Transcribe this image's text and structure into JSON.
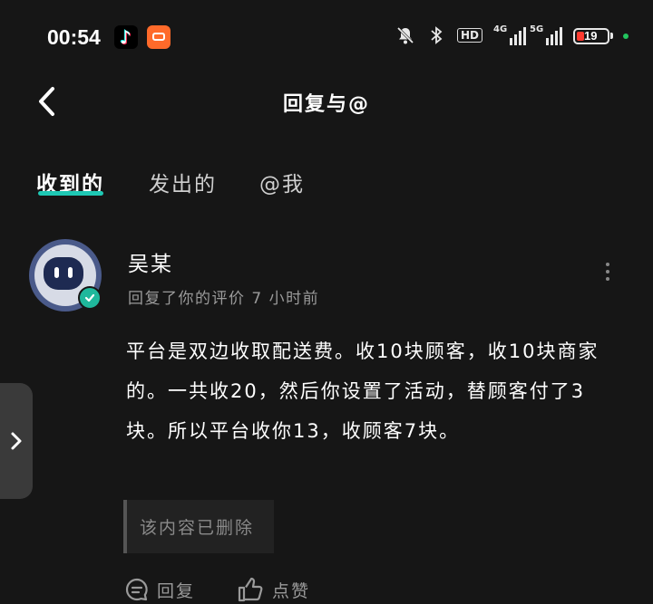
{
  "status_bar": {
    "time": "00:54",
    "icons": [
      "tiktok-icon",
      "kuaikan-icon",
      "mute-icon",
      "bluetooth-icon",
      "hd-icon",
      "signal-4g-icon",
      "signal-5g-icon",
      "battery-icon"
    ],
    "hd_label": "HD",
    "net1_label": "4G",
    "net2_label": "5G",
    "battery": "19",
    "charge_color": "#22c55e"
  },
  "header": {
    "title": "回复与@"
  },
  "tabs": [
    {
      "label": "收到的",
      "active": true
    },
    {
      "label": "发出的",
      "active": false
    },
    {
      "label": "@我",
      "active": false
    }
  ],
  "accent_color": "#1ec8b4",
  "notification": {
    "username": "吴某",
    "meta": "回复了你的评价 7 小时前",
    "comment": "平台是双边收取配送费。收10块顾客，收10块商家的。一共收20，然后你设置了活动，替顾客付了3块。所以平台收你13，收顾客7块。",
    "quoted": "该内容已删除",
    "actions": {
      "reply": "回复",
      "like": "点赞"
    }
  }
}
